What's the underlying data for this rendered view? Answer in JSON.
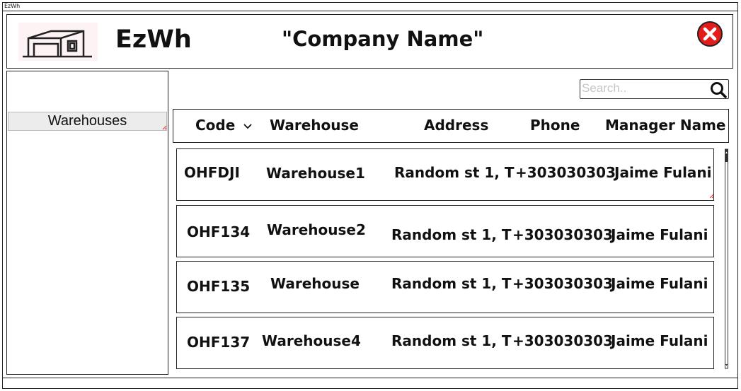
{
  "window": {
    "title": "EzWh"
  },
  "header": {
    "brand": "EzWh",
    "company": "\"Company Name\""
  },
  "sidebar": {
    "items": [
      {
        "label": "Warehouses"
      }
    ]
  },
  "search": {
    "placeholder": "Search.."
  },
  "table": {
    "columns": [
      "Code",
      "Warehouse",
      "Address",
      "Phone",
      "Manager Name"
    ],
    "rows": [
      [
        "OHFDJI",
        "Warehouse1",
        "Random st 1, T",
        "+303030303",
        "Jaime Fulani"
      ],
      [
        "OHF134",
        "Warehouse2",
        "Random st 1, T",
        "+303030303",
        "Jaime Fulani"
      ],
      [
        "OHF135",
        "Warehouse",
        "Random st 1, T",
        "+303030303",
        "Jaime Fulani"
      ],
      [
        "OHF137",
        "Warehouse4",
        "Random st 1, T",
        "+303030303",
        "Jaime Fulani"
      ]
    ]
  },
  "colors": {
    "close": "#e31b1b",
    "selected": "#ececec"
  },
  "icons": [
    "warehouse-logo-icon",
    "close-icon",
    "search-icon",
    "chevron-down-icon",
    "resize-corner-icon",
    "scroll-up-icon",
    "scroll-down-icon"
  ]
}
